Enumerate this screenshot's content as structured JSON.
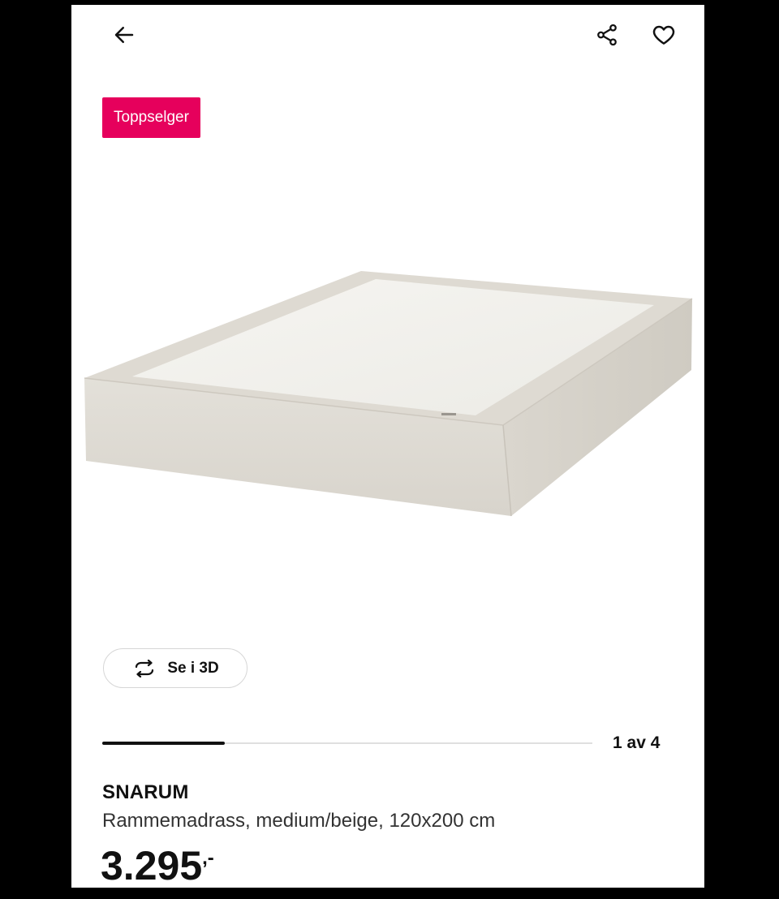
{
  "header": {
    "back_icon": "arrow-left-icon",
    "share_icon": "share-icon",
    "favourite_icon": "heart-icon"
  },
  "badge": {
    "label": "Toppselger",
    "color": "#e6005c"
  },
  "gallery": {
    "view3d_label": "Se i 3D",
    "view3d_icon": "rotate-3d-icon",
    "counter": "1 av 4",
    "progress": 0.25
  },
  "product": {
    "name": "SNARUM",
    "description": "Rammemadrass, medium/beige, 120x200 cm",
    "price": "3.295",
    "price_suffix": ",-"
  }
}
